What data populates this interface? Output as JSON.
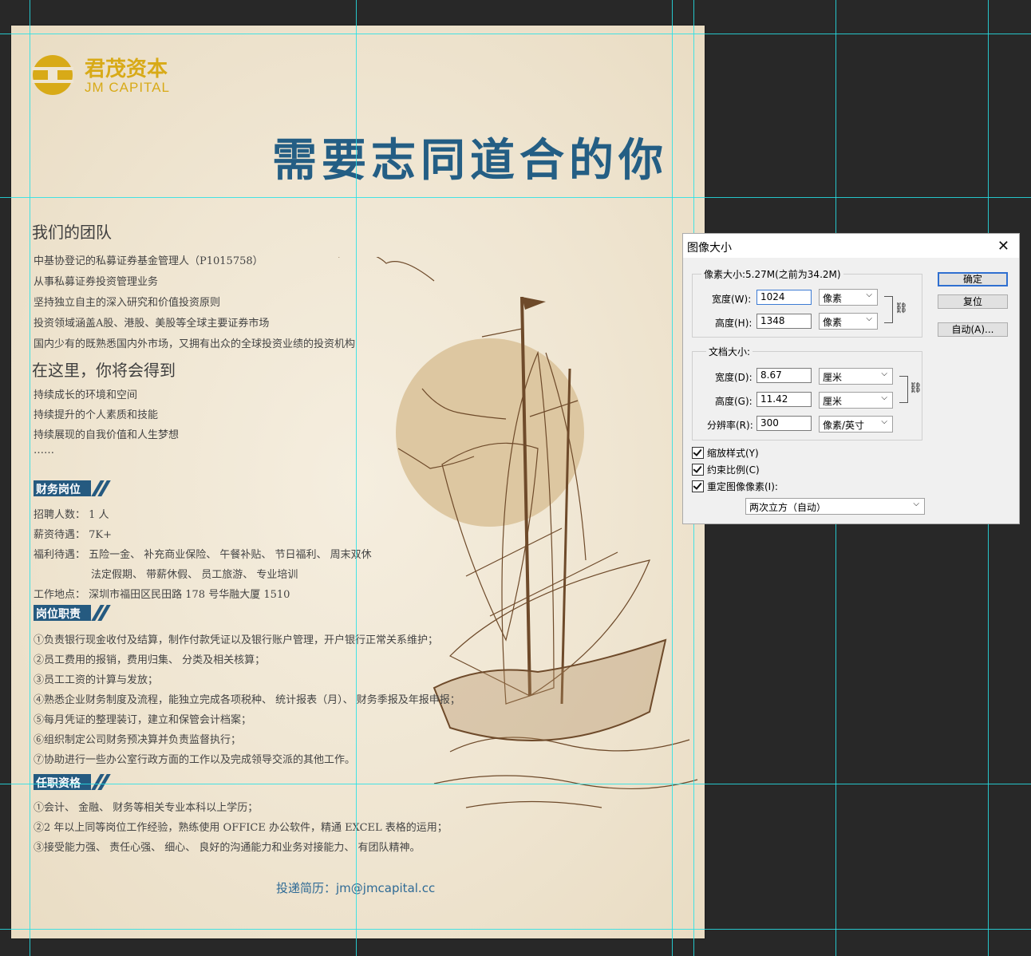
{
  "poster": {
    "logo_cn": "君茂资本",
    "logo_en": "JM CAPITAL",
    "headline": "需要志同道合的你",
    "team_heading": "我们的团队",
    "team_lines": [
      "中基协登记的私募证券基金管理人（P1015758）",
      "从事私募证券投资管理业务",
      "坚持独立自主的深入研究和价值投资原则",
      "投资领域涵盖A股、港股、美股等全球主要证券市场",
      "国内少有的既熟悉国内外市场，又拥有出众的全球投资业绩的投资机构"
    ],
    "gain_heading": "在这里，你将会得到",
    "gain_lines": [
      "持续成长的环境和空间",
      "持续提升的个人素质和技能",
      "持续展现的自我价值和人生梦想",
      "……"
    ],
    "badge_job": "财务岗位",
    "job_lines": [
      "招聘人数： 1 人",
      "薪资待遇： 7K+",
      "福利待遇： 五险一金、 补充商业保险、 午餐补贴、 节日福利、 周末双休",
      "法定假期、 带薪休假、 员工旅游、 专业培训",
      "工作地点： 深圳市福田区民田路 178 号华融大厦 1510"
    ],
    "badge_duty": "岗位职责",
    "duty_lines": [
      "①负责银行现金收付及结算，制作付款凭证以及银行账户管理，开户银行正常关系维护；",
      "②员工费用的报销，费用归集、 分类及相关核算；",
      "③员工工资的计算与发放；",
      "④熟悉企业财务制度及流程，能独立完成各项税种、 统计报表（月）、 财务季报及年报申报；",
      "⑤每月凭证的整理装订，建立和保管会计档案；",
      "⑥组织制定公司财务预决算并负责监督执行；",
      "⑦协助进行一些办公室行政方面的工作以及完成领导交派的其他工作。"
    ],
    "badge_req": "任职资格",
    "req_lines": [
      "①会计、 金融、 财务等相关专业本科以上学历；",
      "②2 年以上同等岗位工作经验，熟练使用 OFFICE 办公软件，精通 EXCEL 表格的运用；",
      "③接受能力强、 责任心强、 细心、 良好的沟通能力和业务对接能力、 有团队精神。"
    ],
    "contact": "投递简历：jm@jmcapital.cc",
    "colors": {
      "gold": "#d8aa17",
      "blue": "#245e84",
      "sun": "#ddc7a1",
      "ship": "#6e4a2a"
    }
  },
  "dialog": {
    "title": "图像大小",
    "pixel_group": "像素大小:5.27M(之前为34.2M)",
    "px_width_label": "宽度(W):",
    "px_width_value": "1024",
    "px_width_unit": "像素",
    "px_height_label": "高度(H):",
    "px_height_value": "1348",
    "px_height_unit": "像素",
    "doc_group": "文档大小:",
    "doc_width_label": "宽度(D):",
    "doc_width_value": "8.67",
    "doc_width_unit": "厘米",
    "doc_height_label": "高度(G):",
    "doc_height_value": "11.42",
    "doc_height_unit": "厘米",
    "res_label": "分辨率(R):",
    "res_value": "300",
    "res_unit": "像素/英寸",
    "chk_scale": "缩放样式(Y)",
    "chk_constrain": "约束比例(C)",
    "chk_resample": "重定图像像素(I):",
    "resample_method": "两次立方（自动）",
    "ok_label": "确定",
    "reset_label": "复位",
    "auto_label": "自动(A)..."
  }
}
